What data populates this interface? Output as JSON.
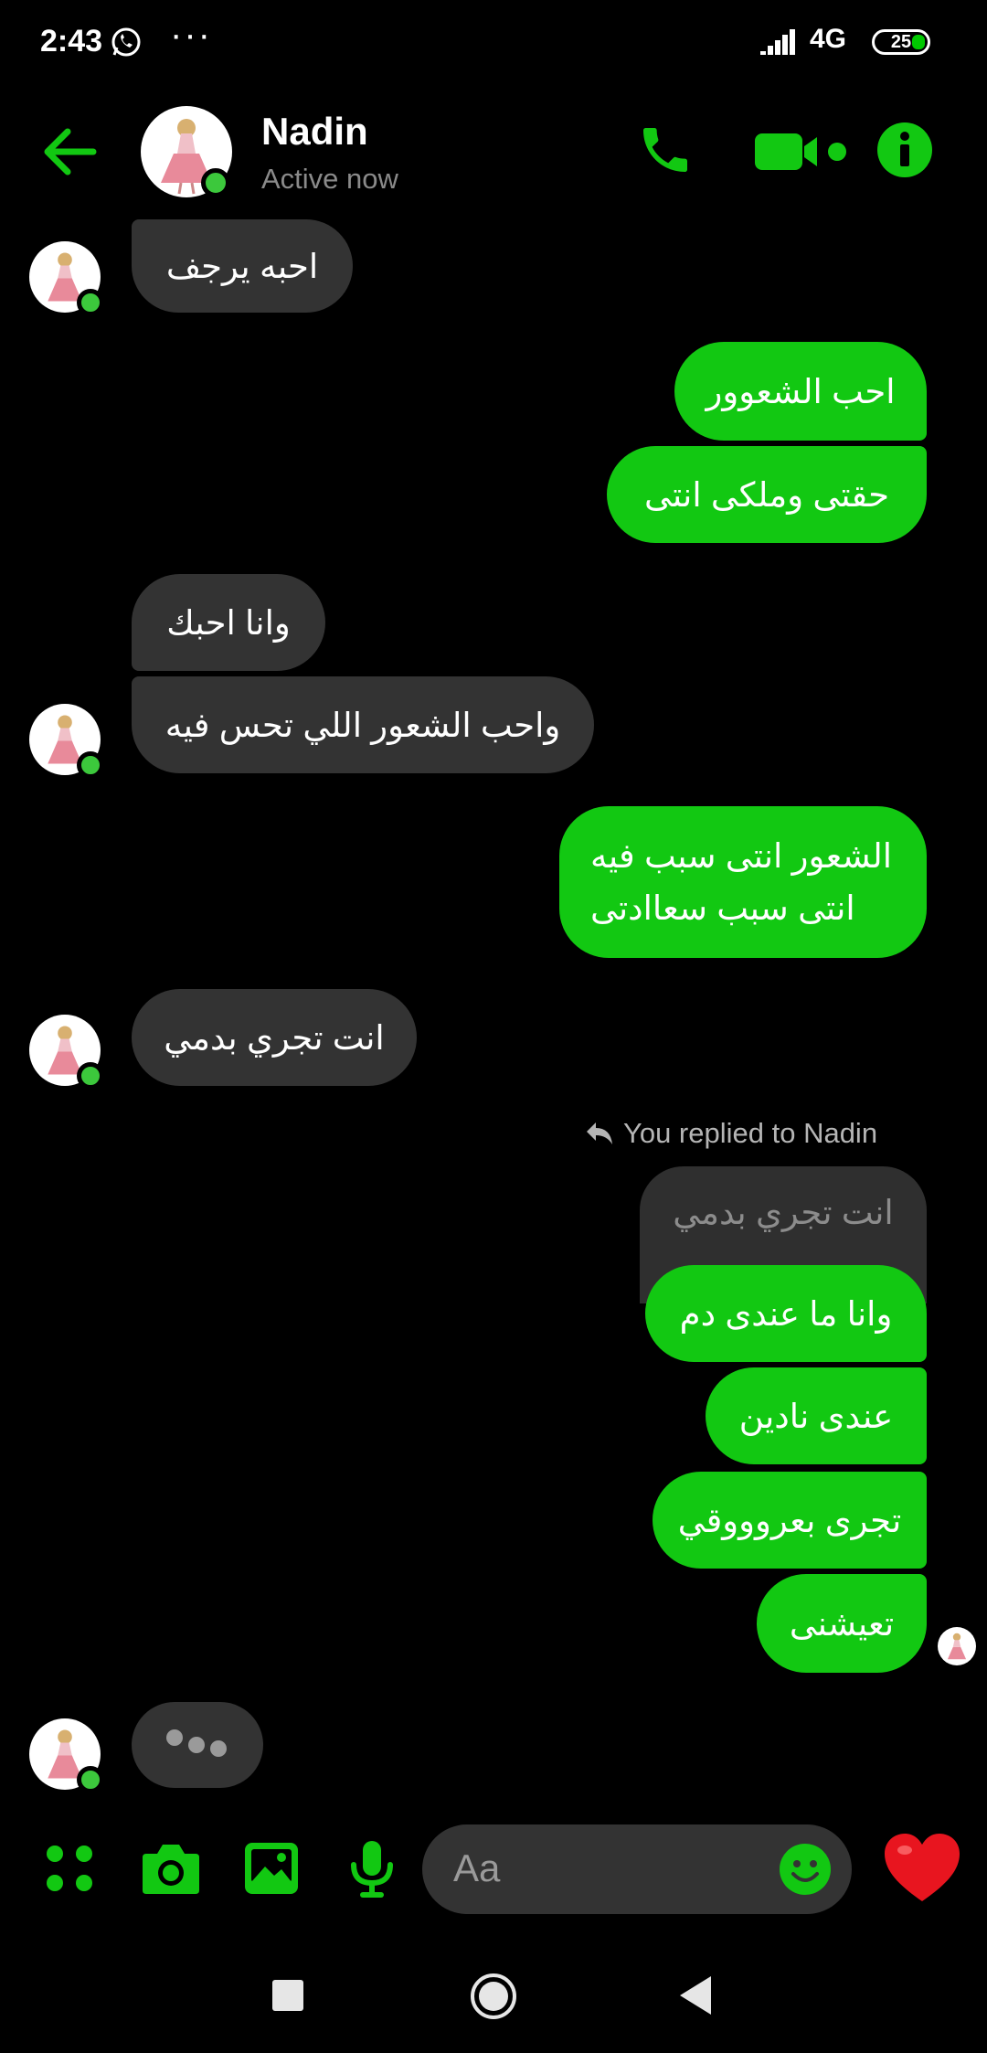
{
  "status_bar": {
    "time": "2:43",
    "more_dots": "···",
    "network": "4G",
    "battery": "25"
  },
  "header": {
    "contact_name": "Nadin",
    "contact_status": "Active now"
  },
  "messages": [
    {
      "side": "in",
      "text": "احبه يرجف"
    },
    {
      "side": "out",
      "text": "احب الشعوور"
    },
    {
      "side": "out",
      "text": "حقتى وملكى انتى"
    },
    {
      "side": "in",
      "text": "وانا احبك"
    },
    {
      "side": "in",
      "text": "واحب الشعور اللي تحس فيه"
    },
    {
      "side": "out",
      "lines": [
        "الشعور انتى سبب فيه",
        "انتى سبب سعاادتى"
      ]
    },
    {
      "side": "in",
      "text": "انت تجري بدمي"
    },
    {
      "side": "out",
      "text": "وانا ما عندى دم"
    },
    {
      "side": "out",
      "text": "عندى نادين"
    },
    {
      "side": "out",
      "text": "تجرى بعروووقي"
    },
    {
      "side": "out",
      "text": "تعيشنى"
    }
  ],
  "reply": {
    "label": "You replied to Nadin",
    "quoted_text": "انت تجري بدمي"
  },
  "composer": {
    "placeholder": "Aa"
  },
  "colors": {
    "accent": "#12c812",
    "incoming_bubble": "#333333",
    "background": "#000000",
    "online_dot": "#3cc83c"
  },
  "icons": [
    "back-arrow-icon",
    "phone-icon",
    "video-camera-icon",
    "info-icon",
    "apps-grid-icon",
    "camera-icon",
    "gallery-icon",
    "microphone-icon",
    "emoji-icon",
    "heart-icon"
  ]
}
